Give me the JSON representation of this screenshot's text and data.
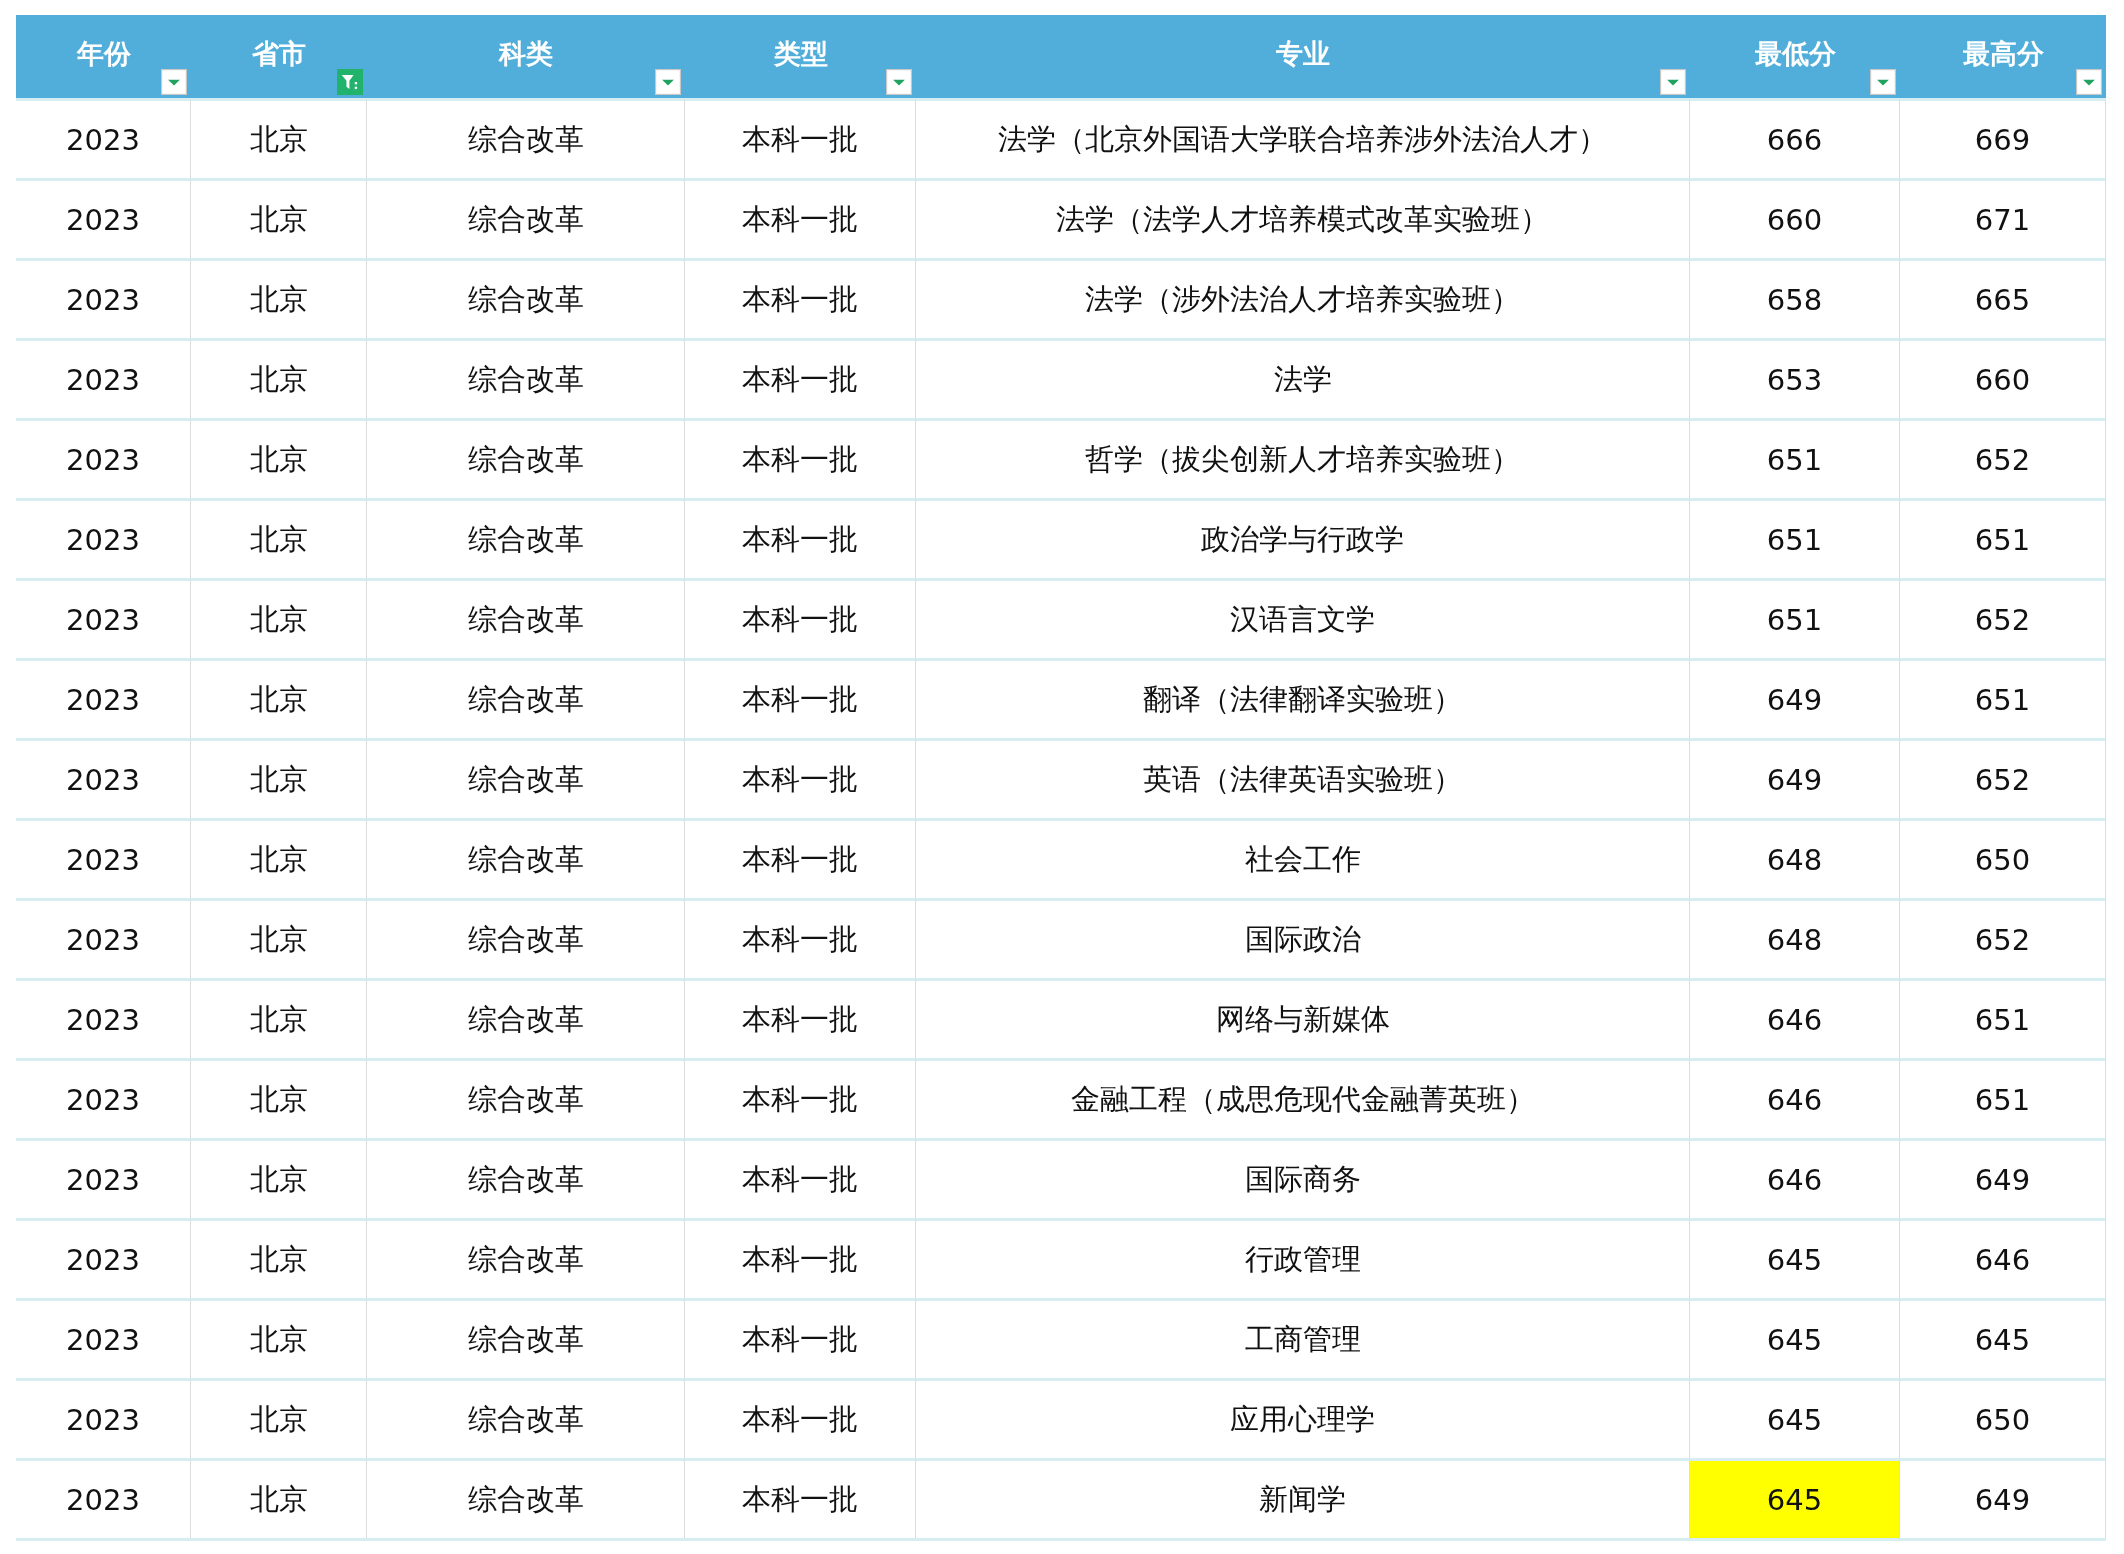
{
  "table": {
    "columns": [
      {
        "label": "年份",
        "filtered": false
      },
      {
        "label": "省市",
        "filtered": true
      },
      {
        "label": "科类",
        "filtered": false
      },
      {
        "label": "类型",
        "filtered": false
      },
      {
        "label": "专业",
        "filtered": false
      },
      {
        "label": "最低分",
        "filtered": false
      },
      {
        "label": "最高分",
        "filtered": false
      }
    ],
    "rows": [
      {
        "cells": [
          {
            "text": "2023",
            "highlighted": false
          },
          {
            "text": "北京",
            "highlighted": false
          },
          {
            "text": "综合改革",
            "highlighted": false
          },
          {
            "text": "本科一批",
            "highlighted": false
          },
          {
            "text": "法学（北京外国语大学联合培养涉外法治人才）",
            "highlighted": false
          },
          {
            "text": "666",
            "highlighted": false
          },
          {
            "text": "669",
            "highlighted": false
          }
        ]
      },
      {
        "cells": [
          {
            "text": "2023",
            "highlighted": false
          },
          {
            "text": "北京",
            "highlighted": false
          },
          {
            "text": "综合改革",
            "highlighted": false
          },
          {
            "text": "本科一批",
            "highlighted": false
          },
          {
            "text": "法学（法学人才培养模式改革实验班）",
            "highlighted": false
          },
          {
            "text": "660",
            "highlighted": false
          },
          {
            "text": "671",
            "highlighted": false
          }
        ]
      },
      {
        "cells": [
          {
            "text": "2023",
            "highlighted": false
          },
          {
            "text": "北京",
            "highlighted": false
          },
          {
            "text": "综合改革",
            "highlighted": false
          },
          {
            "text": "本科一批",
            "highlighted": false
          },
          {
            "text": "法学（涉外法治人才培养实验班）",
            "highlighted": false
          },
          {
            "text": "658",
            "highlighted": false
          },
          {
            "text": "665",
            "highlighted": false
          }
        ]
      },
      {
        "cells": [
          {
            "text": "2023",
            "highlighted": false
          },
          {
            "text": "北京",
            "highlighted": false
          },
          {
            "text": "综合改革",
            "highlighted": false
          },
          {
            "text": "本科一批",
            "highlighted": false
          },
          {
            "text": "法学",
            "highlighted": false
          },
          {
            "text": "653",
            "highlighted": false
          },
          {
            "text": "660",
            "highlighted": false
          }
        ]
      },
      {
        "cells": [
          {
            "text": "2023",
            "highlighted": false
          },
          {
            "text": "北京",
            "highlighted": false
          },
          {
            "text": "综合改革",
            "highlighted": false
          },
          {
            "text": "本科一批",
            "highlighted": false
          },
          {
            "text": "哲学（拔尖创新人才培养实验班）",
            "highlighted": false
          },
          {
            "text": "651",
            "highlighted": false
          },
          {
            "text": "652",
            "highlighted": false
          }
        ]
      },
      {
        "cells": [
          {
            "text": "2023",
            "highlighted": false
          },
          {
            "text": "北京",
            "highlighted": false
          },
          {
            "text": "综合改革",
            "highlighted": false
          },
          {
            "text": "本科一批",
            "highlighted": false
          },
          {
            "text": "政治学与行政学",
            "highlighted": false
          },
          {
            "text": "651",
            "highlighted": false
          },
          {
            "text": "651",
            "highlighted": false
          }
        ]
      },
      {
        "cells": [
          {
            "text": "2023",
            "highlighted": false
          },
          {
            "text": "北京",
            "highlighted": false
          },
          {
            "text": "综合改革",
            "highlighted": false
          },
          {
            "text": "本科一批",
            "highlighted": false
          },
          {
            "text": "汉语言文学",
            "highlighted": false
          },
          {
            "text": "651",
            "highlighted": false
          },
          {
            "text": "652",
            "highlighted": false
          }
        ]
      },
      {
        "cells": [
          {
            "text": "2023",
            "highlighted": false
          },
          {
            "text": "北京",
            "highlighted": false
          },
          {
            "text": "综合改革",
            "highlighted": false
          },
          {
            "text": "本科一批",
            "highlighted": false
          },
          {
            "text": "翻译（法律翻译实验班）",
            "highlighted": false
          },
          {
            "text": "649",
            "highlighted": false
          },
          {
            "text": "651",
            "highlighted": false
          }
        ]
      },
      {
        "cells": [
          {
            "text": "2023",
            "highlighted": false
          },
          {
            "text": "北京",
            "highlighted": false
          },
          {
            "text": "综合改革",
            "highlighted": false
          },
          {
            "text": "本科一批",
            "highlighted": false
          },
          {
            "text": "英语（法律英语实验班）",
            "highlighted": false
          },
          {
            "text": "649",
            "highlighted": false
          },
          {
            "text": "652",
            "highlighted": false
          }
        ]
      },
      {
        "cells": [
          {
            "text": "2023",
            "highlighted": false
          },
          {
            "text": "北京",
            "highlighted": false
          },
          {
            "text": "综合改革",
            "highlighted": false
          },
          {
            "text": "本科一批",
            "highlighted": false
          },
          {
            "text": "社会工作",
            "highlighted": false
          },
          {
            "text": "648",
            "highlighted": false
          },
          {
            "text": "650",
            "highlighted": false
          }
        ]
      },
      {
        "cells": [
          {
            "text": "2023",
            "highlighted": false
          },
          {
            "text": "北京",
            "highlighted": false
          },
          {
            "text": "综合改革",
            "highlighted": false
          },
          {
            "text": "本科一批",
            "highlighted": false
          },
          {
            "text": "国际政治",
            "highlighted": false
          },
          {
            "text": "648",
            "highlighted": false
          },
          {
            "text": "652",
            "highlighted": false
          }
        ]
      },
      {
        "cells": [
          {
            "text": "2023",
            "highlighted": false
          },
          {
            "text": "北京",
            "highlighted": false
          },
          {
            "text": "综合改革",
            "highlighted": false
          },
          {
            "text": "本科一批",
            "highlighted": false
          },
          {
            "text": "网络与新媒体",
            "highlighted": false
          },
          {
            "text": "646",
            "highlighted": false
          },
          {
            "text": "651",
            "highlighted": false
          }
        ]
      },
      {
        "cells": [
          {
            "text": "2023",
            "highlighted": false
          },
          {
            "text": "北京",
            "highlighted": false
          },
          {
            "text": "综合改革",
            "highlighted": false
          },
          {
            "text": "本科一批",
            "highlighted": false
          },
          {
            "text": "金融工程（成思危现代金融菁英班）",
            "highlighted": false
          },
          {
            "text": "646",
            "highlighted": false
          },
          {
            "text": "651",
            "highlighted": false
          }
        ]
      },
      {
        "cells": [
          {
            "text": "2023",
            "highlighted": false
          },
          {
            "text": "北京",
            "highlighted": false
          },
          {
            "text": "综合改革",
            "highlighted": false
          },
          {
            "text": "本科一批",
            "highlighted": false
          },
          {
            "text": "国际商务",
            "highlighted": false
          },
          {
            "text": "646",
            "highlighted": false
          },
          {
            "text": "649",
            "highlighted": false
          }
        ]
      },
      {
        "cells": [
          {
            "text": "2023",
            "highlighted": false
          },
          {
            "text": "北京",
            "highlighted": false
          },
          {
            "text": "综合改革",
            "highlighted": false
          },
          {
            "text": "本科一批",
            "highlighted": false
          },
          {
            "text": "行政管理",
            "highlighted": false
          },
          {
            "text": "645",
            "highlighted": false
          },
          {
            "text": "646",
            "highlighted": false
          }
        ]
      },
      {
        "cells": [
          {
            "text": "2023",
            "highlighted": false
          },
          {
            "text": "北京",
            "highlighted": false
          },
          {
            "text": "综合改革",
            "highlighted": false
          },
          {
            "text": "本科一批",
            "highlighted": false
          },
          {
            "text": "工商管理",
            "highlighted": false
          },
          {
            "text": "645",
            "highlighted": false
          },
          {
            "text": "645",
            "highlighted": false
          }
        ]
      },
      {
        "cells": [
          {
            "text": "2023",
            "highlighted": false
          },
          {
            "text": "北京",
            "highlighted": false
          },
          {
            "text": "综合改革",
            "highlighted": false
          },
          {
            "text": "本科一批",
            "highlighted": false
          },
          {
            "text": "应用心理学",
            "highlighted": false
          },
          {
            "text": "645",
            "highlighted": false
          },
          {
            "text": "650",
            "highlighted": false
          }
        ]
      },
      {
        "cells": [
          {
            "text": "2023",
            "highlighted": false
          },
          {
            "text": "北京",
            "highlighted": false
          },
          {
            "text": "综合改革",
            "highlighted": false
          },
          {
            "text": "本科一批",
            "highlighted": false
          },
          {
            "text": "新闻学",
            "highlighted": false
          },
          {
            "text": "645",
            "highlighted": true
          },
          {
            "text": "649",
            "highlighted": false
          }
        ]
      }
    ]
  }
}
